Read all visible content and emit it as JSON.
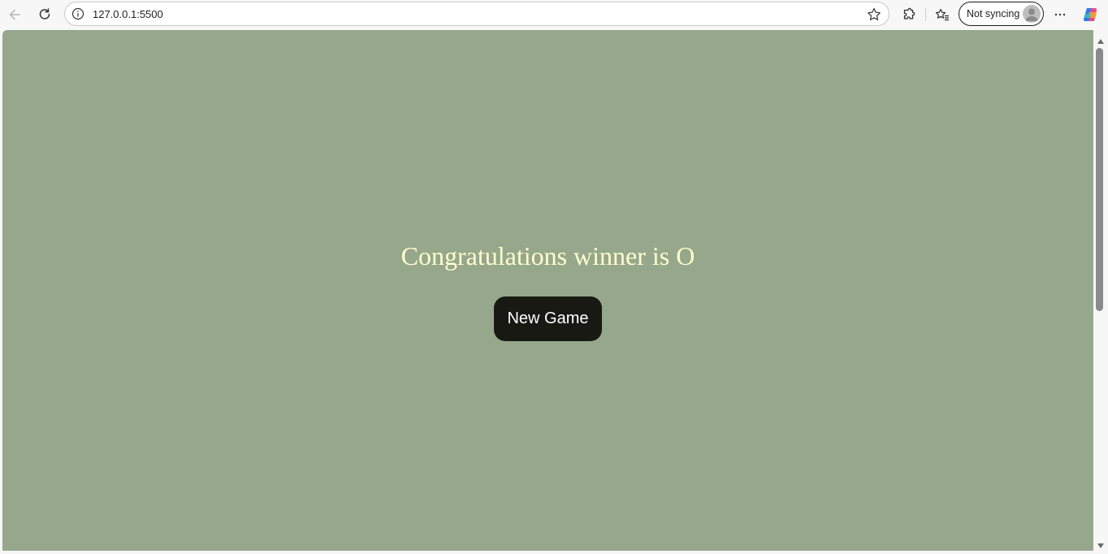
{
  "browser": {
    "url": "127.0.0.1:5500",
    "profile_status": "Not syncing"
  },
  "page": {
    "background_color": "#96a78c",
    "message": "Congratulations winner is O",
    "message_color": "#fefecd",
    "new_game_label": "New Game",
    "button_color": "#191913"
  },
  "icons": {
    "back": "back-arrow-icon",
    "refresh": "refresh-icon",
    "site_info": "info-icon",
    "favorite": "star-icon",
    "extensions": "puzzle-icon",
    "favorites_list": "favorites-icon",
    "more": "more-dots-icon",
    "copilot": "copilot-icon",
    "avatar": "avatar-icon"
  }
}
